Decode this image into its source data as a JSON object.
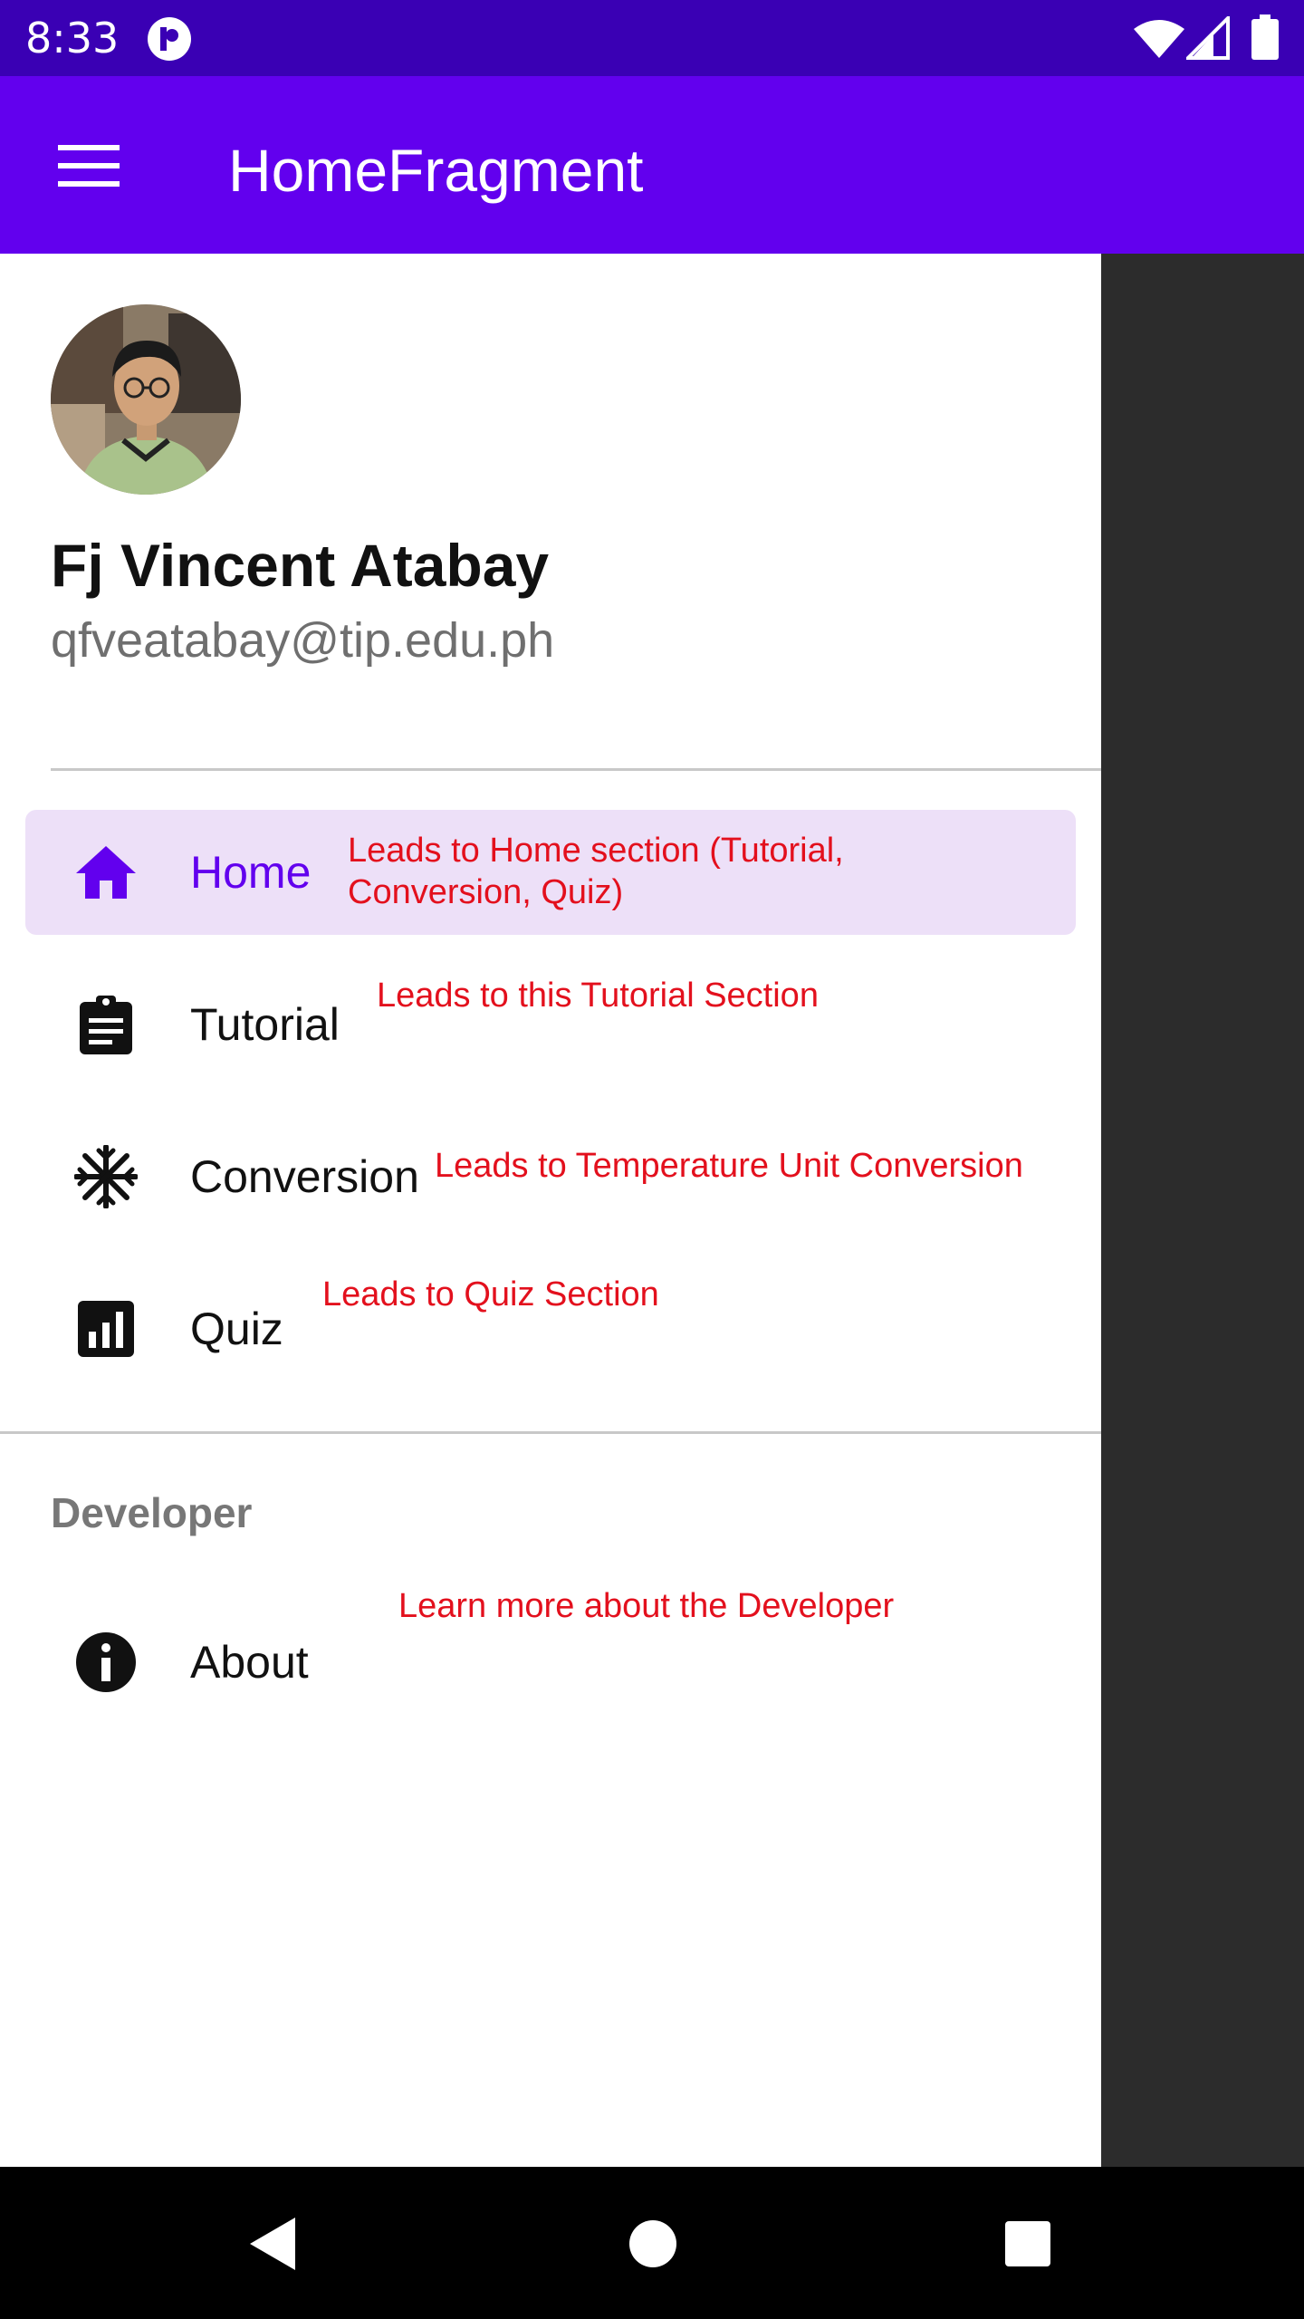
{
  "status_bar": {
    "time": "8:33"
  },
  "app_bar": {
    "title": "HomeFragment"
  },
  "drawer": {
    "user": {
      "name": "Fj Vincent Atabay",
      "email": "qfveatabay@tip.edu.ph"
    },
    "items": [
      {
        "label": "Home",
        "icon": "home-icon",
        "active": true
      },
      {
        "label": "Tutorial",
        "icon": "clipboard-icon"
      },
      {
        "label": "Conversion",
        "icon": "snowflake-icon"
      },
      {
        "label": "Quiz",
        "icon": "bar-chart-icon"
      }
    ],
    "section_header": "Developer",
    "about": {
      "label": "About",
      "icon": "info-icon"
    }
  },
  "annotations": {
    "home_line1": "Leads to Home section (Tutorial,",
    "home_line2": "Conversion, Quiz)",
    "tutorial": "Leads to this Tutorial Section",
    "conversion": "Leads to Temperature Unit Conversion",
    "quiz": "Leads to Quiz Section",
    "about": "Learn more about the Developer"
  },
  "colors": {
    "status_bar": "#3a00b4",
    "app_bar": "#6200ee",
    "active_item_bg": "#ede0f8",
    "annotation": "#e3101d",
    "scrim": "#2c2c2c"
  }
}
